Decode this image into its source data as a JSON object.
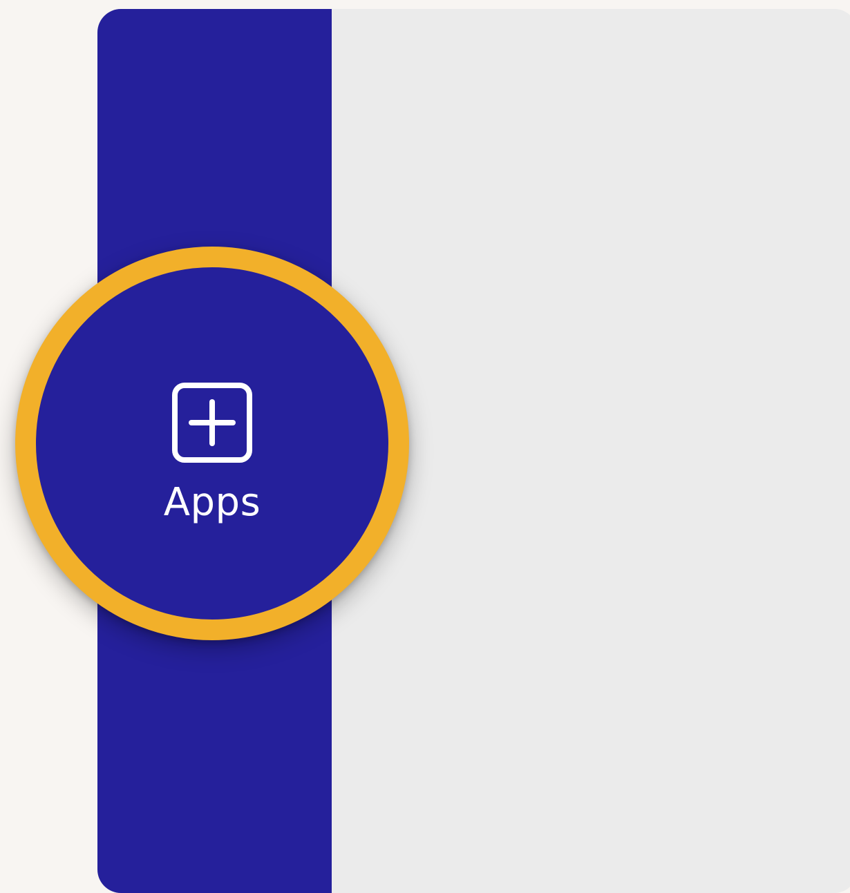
{
  "colors": {
    "page_background": "#f8f5f2",
    "rail_background": "#25209b",
    "content_background": "#ebebeb",
    "highlight_ring": "#f2b02a",
    "label_text": "#ffffff"
  },
  "sidebar": {
    "items": [
      {
        "label": "Apps",
        "icon": "add-square-icon",
        "highlighted": true
      }
    ]
  }
}
